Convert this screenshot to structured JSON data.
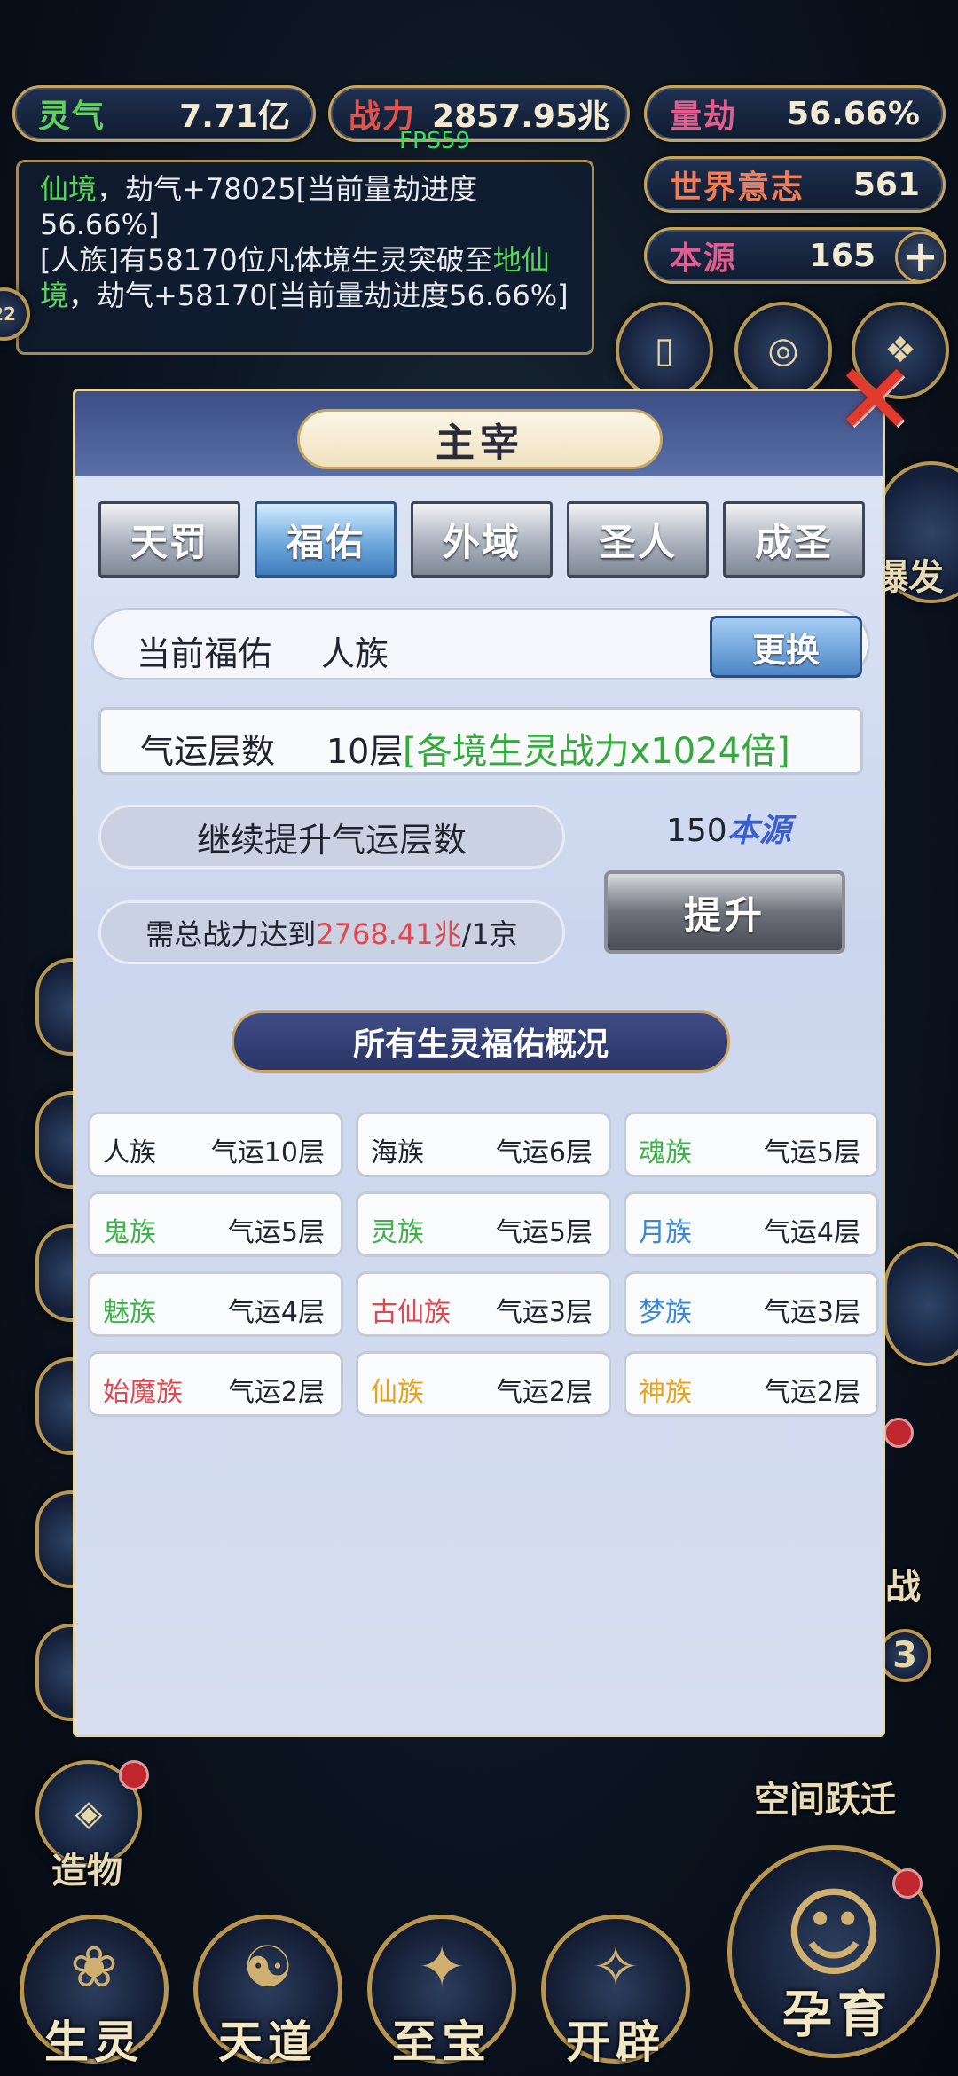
{
  "hud": {
    "lingqi": {
      "label": "灵气",
      "value": "7.71亿"
    },
    "zhanli": {
      "label": "战力",
      "value": "2857.95兆"
    },
    "liangjie": {
      "label": "量劫",
      "value": "56.66%"
    },
    "shijie": {
      "label": "世界意志",
      "value": "561"
    },
    "benyuan": {
      "label": "本源",
      "value": "165",
      "plus": "+"
    },
    "fps": "FPS59"
  },
  "log": {
    "line1_green": "仙境",
    "line1_rest": "，劫气+78025[当前量劫进度56.66%]",
    "line2_pre": "[人族]有58170位凡体境生灵突破至",
    "line2_green": "地仙境",
    "line2_rest": "，劫气+58170[当前量劫进度56.66%]"
  },
  "side": {
    "left_edge": "22",
    "right_baofa": "爆发",
    "space_jump": "空间跃迁",
    "zaowu": "造物",
    "right_num": "3",
    "right_zhan": "战"
  },
  "dialog": {
    "title": "主宰",
    "close": "✕",
    "tabs": [
      "天罚",
      "福佑",
      "外域",
      "圣人",
      "成圣"
    ],
    "current": {
      "label": "当前福佑",
      "value": "人族",
      "swap": "更换"
    },
    "luck": {
      "label": "气运层数",
      "value": "10层",
      "bonus": "[各境生灵战力x1024倍]"
    },
    "upgrade": {
      "label": "继续提升气运层数",
      "cost_num": "150",
      "cost_unit": "本源",
      "req_pre": "需总战力达到",
      "req_val": "2768.41兆",
      "req_post": "/1京",
      "button": "提升"
    },
    "overview_title": "所有生灵福佑概况",
    "races": [
      {
        "name": "人族",
        "level": "气运10层",
        "color": "#1f2430"
      },
      {
        "name": "海族",
        "level": "气运6层",
        "color": "#1f2430"
      },
      {
        "name": "魂族",
        "level": "气运5层",
        "color": "#3fb04a"
      },
      {
        "name": "鬼族",
        "level": "气运5层",
        "color": "#3fb04a"
      },
      {
        "name": "灵族",
        "level": "气运5层",
        "color": "#3fb04a"
      },
      {
        "name": "月族",
        "level": "气运4层",
        "color": "#3b88d6"
      },
      {
        "name": "魅族",
        "level": "气运4层",
        "color": "#3fb04a"
      },
      {
        "name": "古仙族",
        "level": "气运3层",
        "color": "#e0484f"
      },
      {
        "name": "梦族",
        "level": "气运3层",
        "color": "#3b88d6"
      },
      {
        "name": "始魔族",
        "level": "气运2层",
        "color": "#e0484f"
      },
      {
        "name": "仙族",
        "level": "气运2层",
        "color": "#e8a21a"
      },
      {
        "name": "神族",
        "level": "气运2层",
        "color": "#e8a21a"
      }
    ]
  },
  "nav": {
    "items": [
      {
        "label": "生灵",
        "icon": "spirit-icon"
      },
      {
        "label": "天道",
        "icon": "heaven-icon"
      },
      {
        "label": "至宝",
        "icon": "treasure-icon"
      },
      {
        "label": "开辟",
        "icon": "create-icon"
      }
    ],
    "big": {
      "label": "孕育",
      "icon": "nurture-icon"
    }
  },
  "colors": {
    "gold": "#c7a45a",
    "green": "#58d65a",
    "red": "#e0484f",
    "blue": "#3b88d6",
    "orange": "#e8a21a"
  }
}
